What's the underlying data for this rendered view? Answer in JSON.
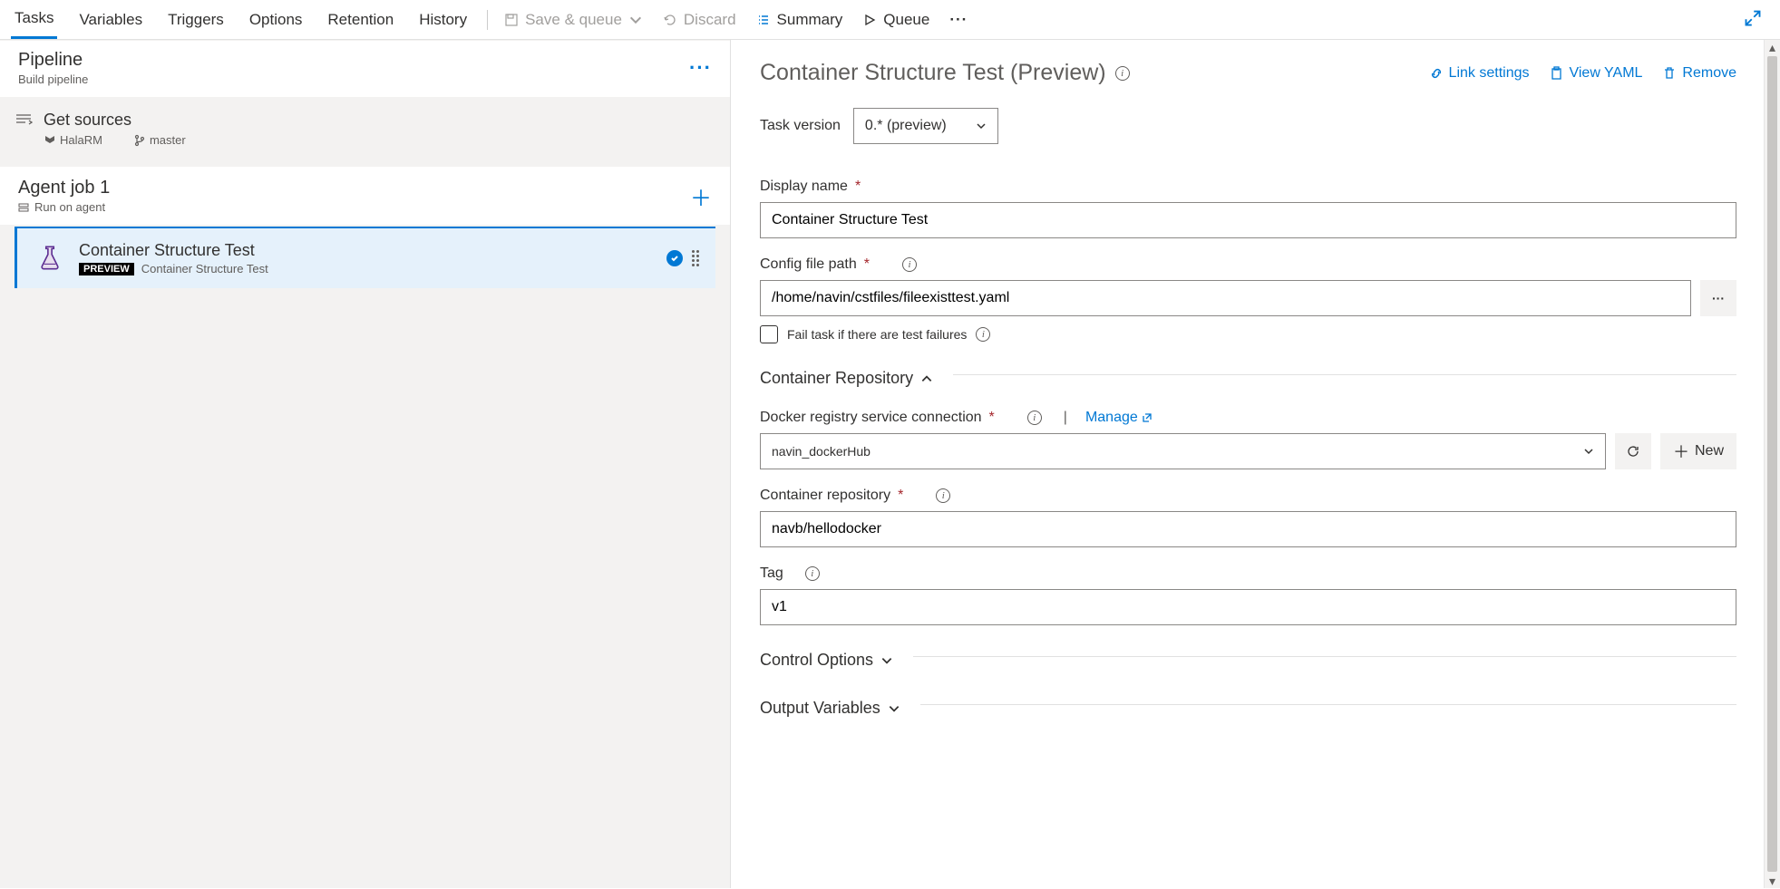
{
  "tabs": [
    "Tasks",
    "Variables",
    "Triggers",
    "Options",
    "Retention",
    "History"
  ],
  "activeTab": "Tasks",
  "topActions": {
    "saveQueue": "Save & queue",
    "discard": "Discard",
    "summary": "Summary",
    "queue": "Queue"
  },
  "left": {
    "pipeline": {
      "title": "Pipeline",
      "sub": "Build pipeline"
    },
    "sources": {
      "title": "Get sources",
      "repo": "HalaRM",
      "branch": "master"
    },
    "agentJob": {
      "title": "Agent job 1",
      "sub": "Run on agent"
    },
    "task": {
      "title": "Container Structure Test",
      "badge": "PREVIEW",
      "sub": "Container Structure Test"
    }
  },
  "detail": {
    "title": "Container Structure Test (Preview)",
    "headerActions": {
      "link": "Link settings",
      "yaml": "View YAML",
      "remove": "Remove"
    },
    "taskVersionLabel": "Task version",
    "taskVersionValue": "0.* (preview)",
    "displayNameLabel": "Display name",
    "displayNameValue": "Container Structure Test",
    "configPathLabel": "Config file path",
    "configPathValue": "/home/navin/cstfiles/fileexisttest.yaml",
    "failTaskLabel": "Fail task if there are test failures",
    "containerRepoSection": "Container Repository",
    "dockerConnLabel": "Docker registry service connection",
    "manage": "Manage",
    "dockerConnValue": "navin_dockerHub",
    "newBtn": "New",
    "containerRepoLabel": "Container repository",
    "containerRepoValue": "navb/hellodocker",
    "tagLabel": "Tag",
    "tagValue": "v1",
    "controlOptions": "Control Options",
    "outputVariables": "Output Variables"
  }
}
